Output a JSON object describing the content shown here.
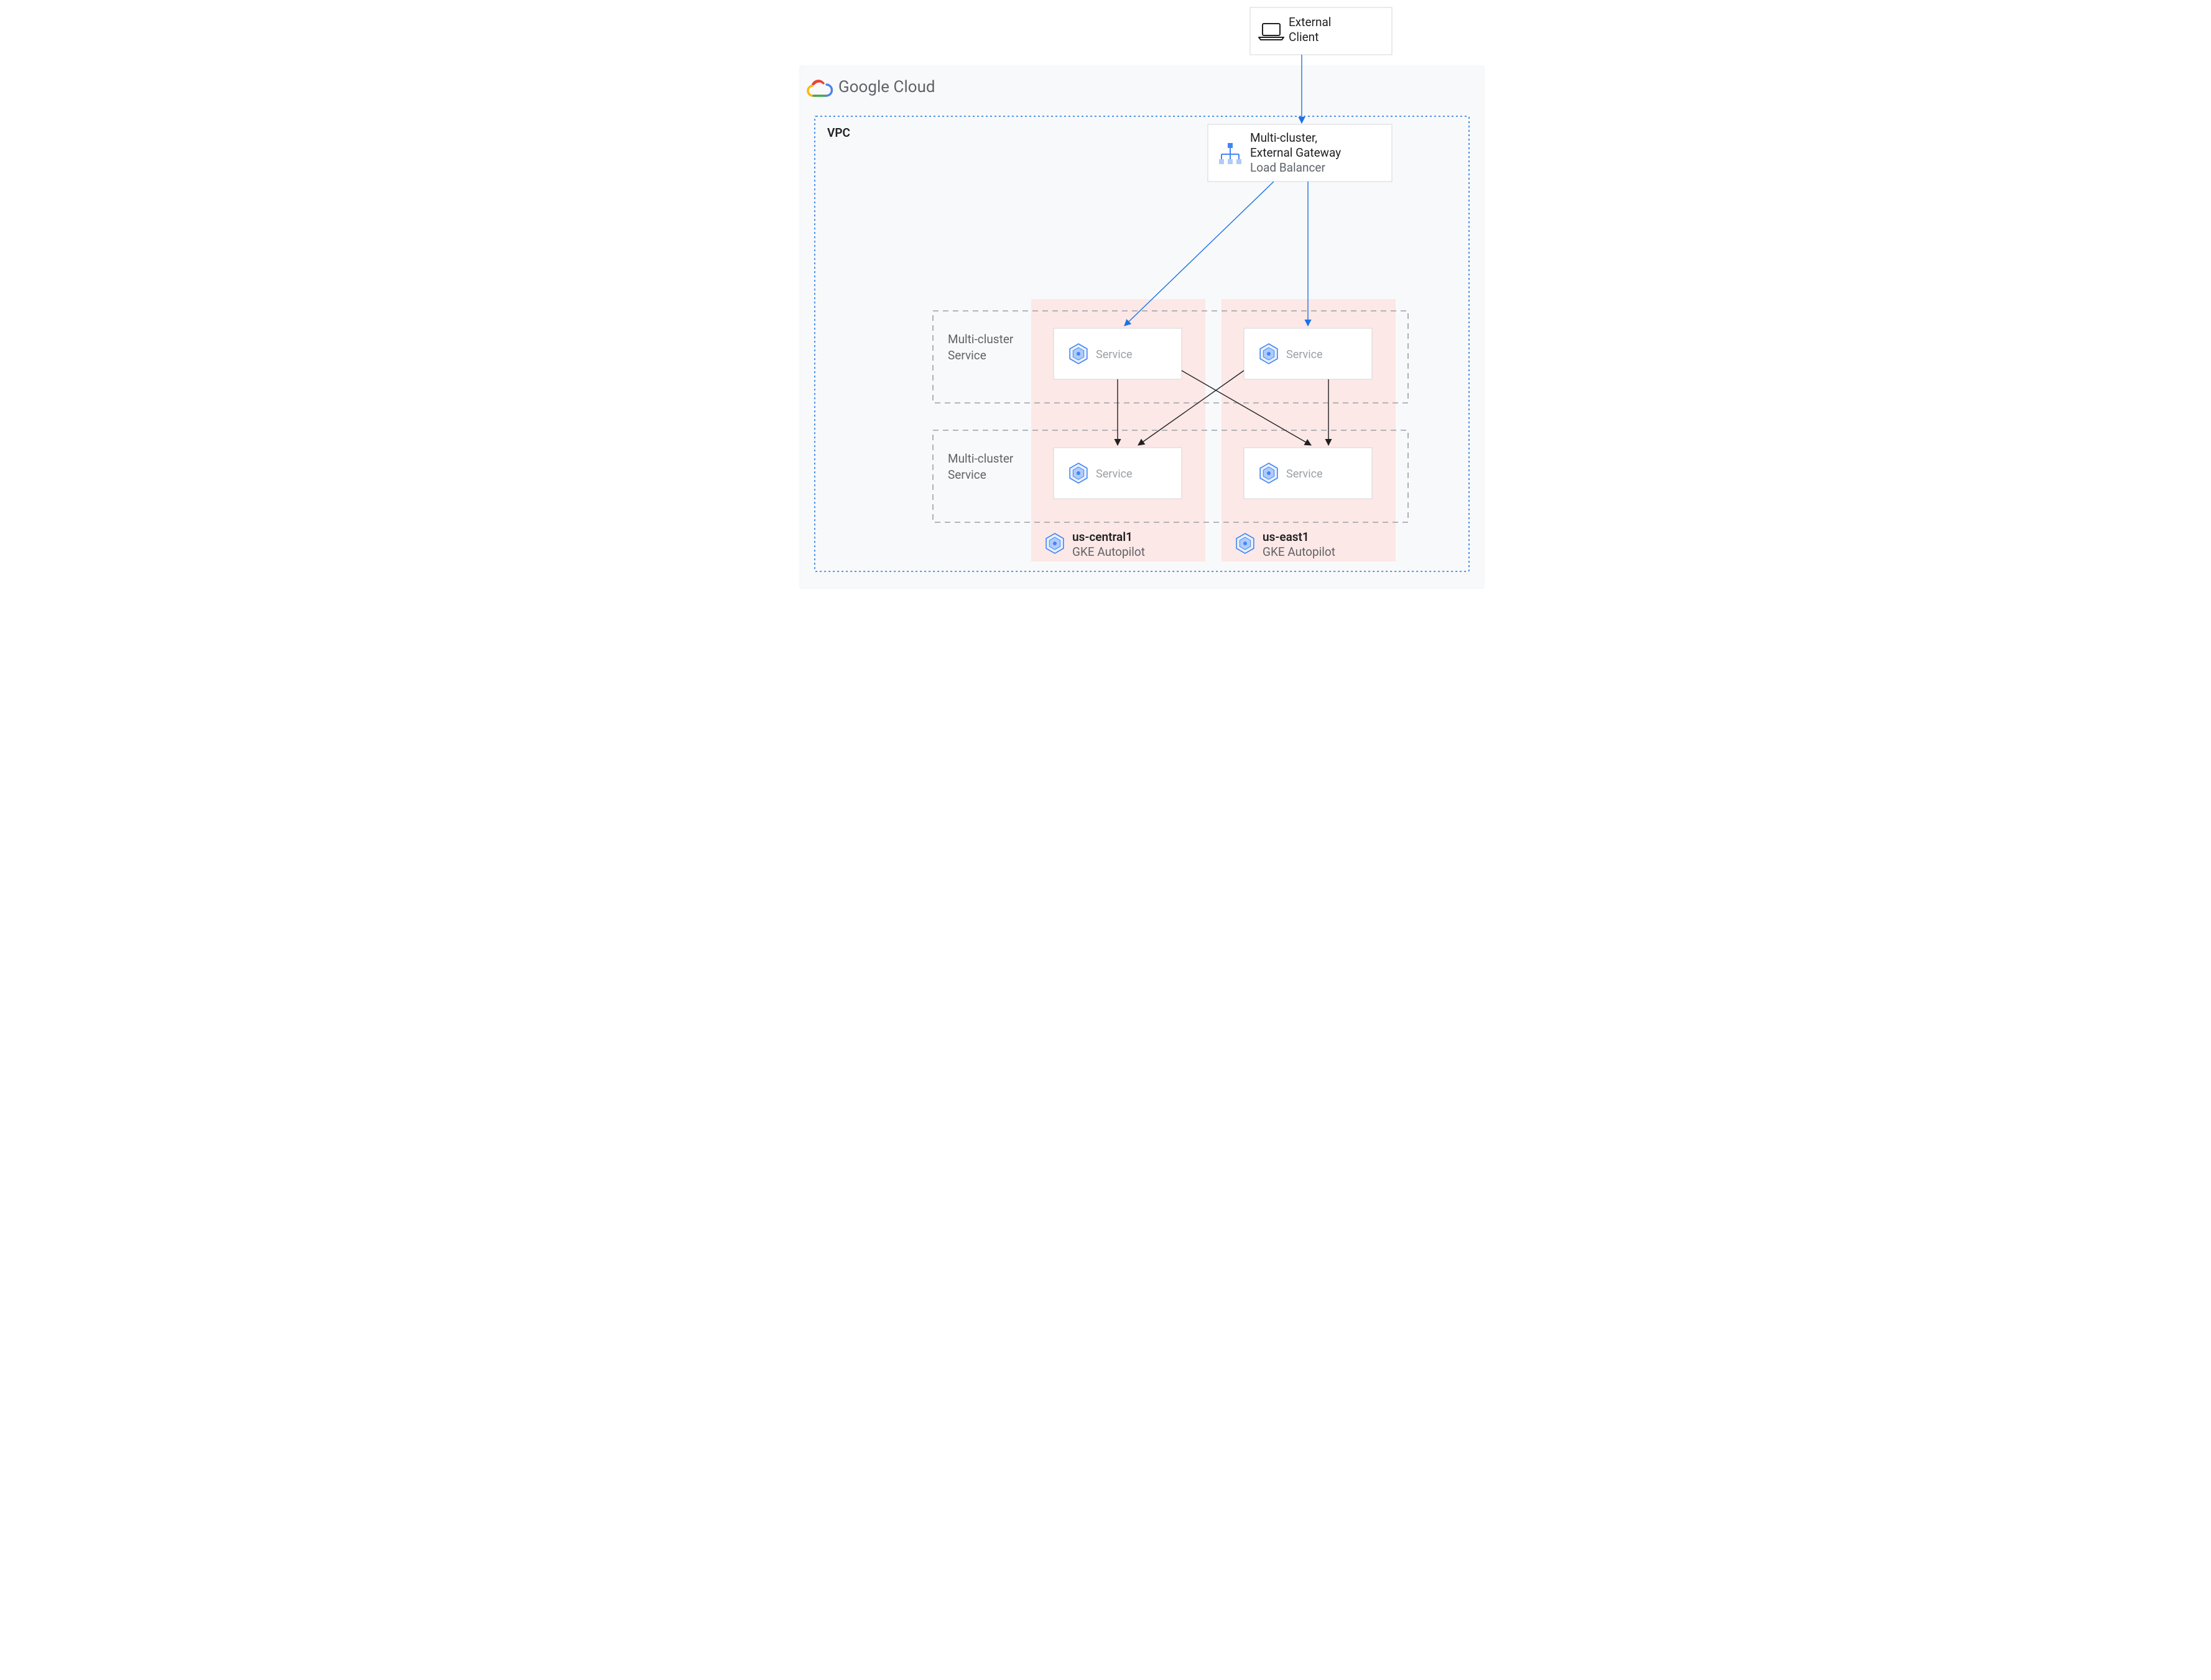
{
  "external": {
    "line1": "External",
    "line2": "Client"
  },
  "cloud_label": "Google Cloud",
  "vpc_label": "VPC",
  "gateway": {
    "line1": "Multi-cluster,",
    "line2": "External Gateway",
    "line3": "Load Balancer"
  },
  "mcs_label1": {
    "line1": "Multi-cluster",
    "line2": "Service"
  },
  "mcs_label2": {
    "line1": "Multi-cluster",
    "line2": "Service"
  },
  "service_label": "Service",
  "cluster_a": {
    "region": "us-central1",
    "kind": "GKE Autopilot"
  },
  "cluster_b": {
    "region": "us-east1",
    "kind": "GKE Autopilot"
  }
}
